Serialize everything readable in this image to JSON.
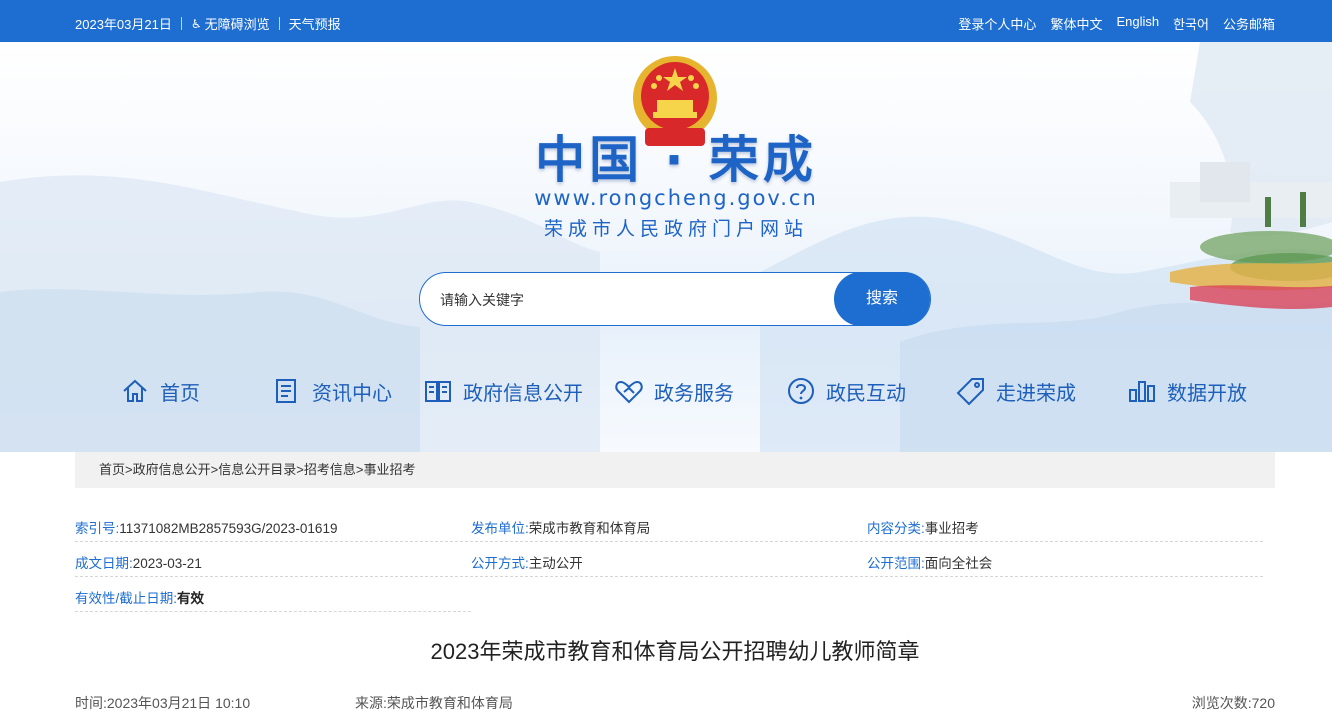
{
  "topbar": {
    "date": "2023年03月21日",
    "accessibility": "无障碍浏览",
    "weather": "天气预报",
    "links": [
      "登录个人中心",
      "繁体中文",
      "English",
      "한국어",
      "公务邮箱"
    ]
  },
  "site": {
    "title": "中国 · 荣成",
    "url": "www.rongcheng.gov.cn",
    "subtitle": "荣成市人民政府门户网站"
  },
  "search": {
    "placeholder": "请输入关键字",
    "button": "搜索"
  },
  "nav": [
    {
      "label": "首页",
      "icon": "home-icon"
    },
    {
      "label": "资讯中心",
      "icon": "news-icon"
    },
    {
      "label": "政府信息公开",
      "icon": "book-icon"
    },
    {
      "label": "政务服务",
      "icon": "handshake-icon"
    },
    {
      "label": "政民互动",
      "icon": "question-icon"
    },
    {
      "label": "走进荣成",
      "icon": "tag-icon"
    },
    {
      "label": "数据开放",
      "icon": "bar-chart-icon"
    }
  ],
  "breadcrumb": [
    "首页",
    "政府信息公开",
    "信息公开目录",
    "招考信息",
    "事业招考"
  ],
  "breadcrumb_sep": ">",
  "meta": {
    "index_label": "索引号:",
    "index_value": "11371082MB2857593G/2023-01619",
    "publisher_label": "发布单位:",
    "publisher_value": "荣成市教育和体育局",
    "category_label": "内容分类:",
    "category_value": "事业招考",
    "date_label": "成文日期:",
    "date_value": "2023-03-21",
    "method_label": "公开方式:",
    "method_value": "主动公开",
    "scope_label": "公开范围:",
    "scope_value": "面向全社会",
    "validity_label": "有效性/截止日期:",
    "validity_value": "有效"
  },
  "article": {
    "title": "2023年荣成市教育和体育局公开招聘幼儿教师简章",
    "time": "时间:2023年03月21日 10:10",
    "source": "来源:荣成市教育和体育局",
    "views": "浏览次数:720"
  },
  "colors": {
    "primary": "#1e6dd0",
    "nav_text": "#1d5fba",
    "label": "#1e6dd0"
  }
}
